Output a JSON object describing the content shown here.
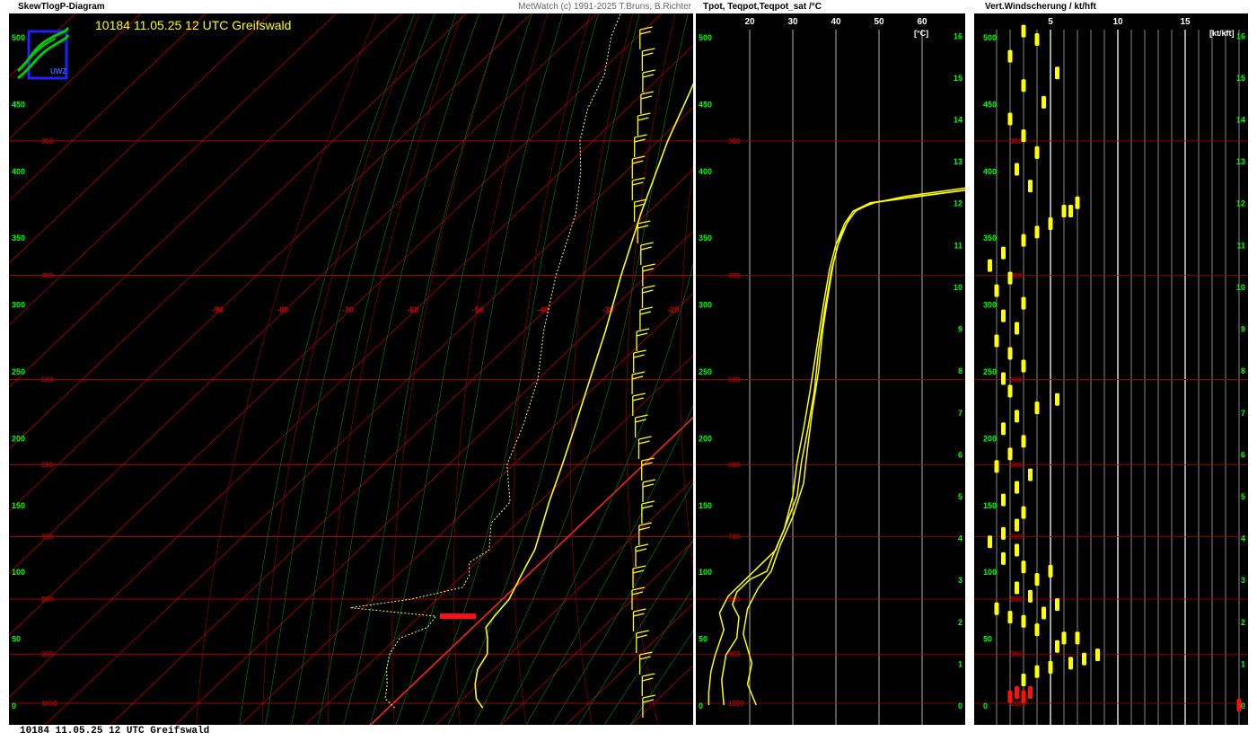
{
  "skewt": {
    "title": "SkewTlogP-Diagram",
    "credit": "MetWatch  (c) 1991-2025 T.Bruns, B.Richter",
    "station_label": "10184 11.05.25 12 UTC Greifswald",
    "logo_text": "UWZ"
  },
  "tpot": {
    "title": "Tpot, Teqpot,Teqpot_sat /°C",
    "unit": "[°C]"
  },
  "shear": {
    "title": "Vert.Windscherung / kt/hft",
    "unit": "[kt/kft]"
  },
  "footer": "10184 11.05.25 12 UTC Greifswald",
  "colors": {
    "background": "#000000",
    "isotherm": "#cc0000",
    "isobar": "#aa0000",
    "dry_adiabat": "#b00000",
    "moist_adiabat": "#008800",
    "temperature": "#ffff00",
    "dewpoint": "#ffff66",
    "axis_green": "#00ff00",
    "zero_isotherm": "#ff2020"
  },
  "chart_data": [
    {
      "type": "line",
      "name_ref": "skewt",
      "pressure_labels": [
        1000,
        900,
        800,
        700,
        600,
        500,
        400,
        300,
        200
      ],
      "pressure_levels": [
        1000,
        900,
        800,
        700,
        600,
        500,
        400,
        300,
        200
      ],
      "isotherm_labels": [
        -90,
        -80,
        -70,
        -60,
        -50,
        -40,
        -30,
        -20,
        -10
      ],
      "height_ticks_hft": [
        0,
        50,
        100,
        150,
        200,
        250,
        300,
        350,
        400,
        450,
        500
      ],
      "temperature_profile": [
        {
          "p": 1010,
          "t": 14.5
        },
        {
          "p": 990,
          "t": 12.0
        },
        {
          "p": 960,
          "t": 9.5
        },
        {
          "p": 930,
          "t": 7.5
        },
        {
          "p": 900,
          "t": 6.5
        },
        {
          "p": 870,
          "t": 4.0
        },
        {
          "p": 850,
          "t": 2.0
        },
        {
          "p": 830,
          "t": 1.5
        },
        {
          "p": 800,
          "t": 1.0
        },
        {
          "p": 780,
          "t": 0.0
        },
        {
          "p": 760,
          "t": -1.0
        },
        {
          "p": 740,
          "t": -2.0
        },
        {
          "p": 720,
          "t": -3.0
        },
        {
          "p": 700,
          "t": -4.5
        },
        {
          "p": 650,
          "t": -8.5
        },
        {
          "p": 600,
          "t": -12.5
        },
        {
          "p": 550,
          "t": -17.0
        },
        {
          "p": 500,
          "t": -22.0
        },
        {
          "p": 450,
          "t": -27.5
        },
        {
          "p": 400,
          "t": -34.0
        },
        {
          "p": 350,
          "t": -41.0
        },
        {
          "p": 300,
          "t": -48.5
        },
        {
          "p": 270,
          "t": -53.0
        },
        {
          "p": 250,
          "t": -56.5
        },
        {
          "p": 230,
          "t": -57.0
        },
        {
          "p": 215,
          "t": -56.0
        },
        {
          "p": 200,
          "t": -55.0
        },
        {
          "p": 190,
          "t": -54.5
        },
        {
          "p": 175,
          "t": -55.0
        },
        {
          "p": 160,
          "t": -55.5
        },
        {
          "p": 150,
          "t": -55.0
        },
        {
          "p": 140,
          "t": -55.5
        },
        {
          "p": 130,
          "t": -56.0
        }
      ],
      "dewpoint_profile": [
        {
          "p": 1010,
          "t": 1.0
        },
        {
          "p": 990,
          "t": -2.0
        },
        {
          "p": 960,
          "t": -4.0
        },
        {
          "p": 930,
          "t": -6.5
        },
        {
          "p": 900,
          "t": -8.5
        },
        {
          "p": 870,
          "t": -9.5
        },
        {
          "p": 850,
          "t": -7.0
        },
        {
          "p": 830,
          "t": -7.5
        },
        {
          "p": 815,
          "t": -22.0
        },
        {
          "p": 800,
          "t": -14.0
        },
        {
          "p": 780,
          "t": -8.0
        },
        {
          "p": 760,
          "t": -9.0
        },
        {
          "p": 740,
          "t": -11.0
        },
        {
          "p": 720,
          "t": -10.0
        },
        {
          "p": 700,
          "t": -12.0
        },
        {
          "p": 680,
          "t": -14.0
        },
        {
          "p": 650,
          "t": -14.5
        },
        {
          "p": 600,
          "t": -21.0
        },
        {
          "p": 550,
          "t": -25.0
        },
        {
          "p": 500,
          "t": -30.0
        },
        {
          "p": 450,
          "t": -37.0
        },
        {
          "p": 400,
          "t": -44.0
        },
        {
          "p": 350,
          "t": -51.0
        },
        {
          "p": 320,
          "t": -57.0
        },
        {
          "p": 300,
          "t": -62.0
        },
        {
          "p": 280,
          "t": -66.0
        },
        {
          "p": 260,
          "t": -69.0
        },
        {
          "p": 240,
          "t": -74.0
        },
        {
          "p": 220,
          "t": -78.0
        },
        {
          "p": 200,
          "t": -82.0
        },
        {
          "p": 180,
          "t": -86.0
        },
        {
          "p": 165,
          "t": -87.0
        },
        {
          "p": 150,
          "t": -86.0
        },
        {
          "p": 135,
          "t": -88.0
        }
      ]
    },
    {
      "type": "line",
      "name_ref": "tpot",
      "x_ticks": [
        20,
        30,
        40,
        50,
        60
      ],
      "height_ticks_kft": [
        0,
        1,
        2,
        3,
        4,
        5,
        6,
        7,
        8,
        9,
        10,
        11,
        12,
        13,
        14,
        15,
        16
      ],
      "xlim": [
        10,
        70
      ],
      "ylim_kft": [
        0,
        16.2
      ],
      "series": [
        {
          "key": "tpot",
          "points": [
            [
              10.5,
              0.0
            ],
            [
              10.5,
              0.3
            ],
            [
              11.0,
              0.8
            ],
            [
              12.0,
              1.2
            ],
            [
              14.0,
              1.8
            ],
            [
              13.0,
              2.2
            ],
            [
              15.0,
              2.6
            ],
            [
              18.0,
              2.9
            ],
            [
              22.0,
              3.3
            ],
            [
              26.0,
              3.7
            ],
            [
              28.0,
              4.2
            ],
            [
              30.0,
              5.0
            ],
            [
              31.0,
              5.8
            ],
            [
              32.5,
              6.6
            ],
            [
              34.0,
              7.5
            ],
            [
              35.5,
              8.5
            ],
            [
              37.0,
              9.5
            ],
            [
              38.5,
              10.4
            ],
            [
              40.0,
              11.0
            ],
            [
              42.0,
              11.5
            ],
            [
              44.0,
              11.8
            ],
            [
              48.0,
              12.0
            ],
            [
              55.0,
              12.1
            ],
            [
              70.0,
              12.3
            ]
          ]
        },
        {
          "key": "teqpot",
          "points": [
            [
              14.0,
              0.0
            ],
            [
              13.5,
              0.6
            ],
            [
              14.5,
              1.2
            ],
            [
              17.0,
              1.6
            ],
            [
              17.5,
              2.1
            ],
            [
              16.0,
              2.4
            ],
            [
              17.0,
              2.7
            ],
            [
              20.0,
              3.0
            ],
            [
              24.0,
              3.2
            ],
            [
              25.5,
              3.6
            ],
            [
              28.0,
              4.2
            ],
            [
              31.0,
              5.0
            ],
            [
              32.0,
              5.8
            ],
            [
              33.5,
              6.6
            ],
            [
              35.0,
              7.5
            ],
            [
              36.0,
              8.5
            ],
            [
              37.5,
              9.5
            ],
            [
              39.0,
              10.4
            ],
            [
              40.5,
              11.0
            ],
            [
              42.5,
              11.5
            ],
            [
              44.5,
              11.8
            ],
            [
              48.5,
              12.0
            ],
            [
              55.5,
              12.1
            ],
            [
              70.0,
              12.3
            ]
          ]
        },
        {
          "key": "teqpot_sat",
          "points": [
            [
              21.5,
              0.0
            ],
            [
              19.5,
              0.5
            ],
            [
              20.5,
              1.0
            ],
            [
              18.5,
              1.7
            ],
            [
              19.5,
              2.3
            ],
            [
              22.0,
              2.8
            ],
            [
              25.0,
              3.2
            ],
            [
              27.0,
              3.8
            ],
            [
              30.0,
              4.5
            ],
            [
              32.5,
              5.3
            ],
            [
              33.5,
              6.2
            ],
            [
              34.5,
              7.0
            ],
            [
              36.0,
              8.0
            ],
            [
              37.0,
              9.0
            ],
            [
              38.5,
              10.0
            ],
            [
              39.5,
              10.6
            ],
            [
              41.0,
              11.2
            ],
            [
              43.0,
              11.6
            ],
            [
              45.0,
              11.85
            ],
            [
              49.0,
              12.0
            ],
            [
              56.0,
              12.15
            ],
            [
              70.0,
              12.35
            ]
          ]
        }
      ]
    },
    {
      "type": "scatter",
      "name_ref": "shear",
      "x_ticks": [
        5,
        10,
        15
      ],
      "height_ticks_kft": [
        0,
        1,
        2,
        3,
        4,
        5,
        6,
        7,
        8,
        9,
        10,
        11,
        12,
        13,
        14,
        15,
        16
      ],
      "xlim": [
        0,
        19
      ],
      "ylim_kft": [
        0,
        16.2
      ],
      "shear_points": [
        [
          2.0,
          0.2,
          "red"
        ],
        [
          2.5,
          0.3,
          "red"
        ],
        [
          3.0,
          0.2,
          "red"
        ],
        [
          3.5,
          0.3,
          "red"
        ],
        [
          19.0,
          0.0,
          "red"
        ],
        [
          3.0,
          0.6,
          "y"
        ],
        [
          4.0,
          0.8,
          "y"
        ],
        [
          5.0,
          0.9,
          "y"
        ],
        [
          6.5,
          1.0,
          "y"
        ],
        [
          7.5,
          1.1,
          "y"
        ],
        [
          8.5,
          1.2,
          "y"
        ],
        [
          5.5,
          1.4,
          "y"
        ],
        [
          6.0,
          1.6,
          "y"
        ],
        [
          7.0,
          1.6,
          "y"
        ],
        [
          4.0,
          1.8,
          "y"
        ],
        [
          3.0,
          2.0,
          "y"
        ],
        [
          2.0,
          2.1,
          "y"
        ],
        [
          1.0,
          2.3,
          "y"
        ],
        [
          4.5,
          2.2,
          "y"
        ],
        [
          5.5,
          2.4,
          "y"
        ],
        [
          3.5,
          2.6,
          "y"
        ],
        [
          2.5,
          2.8,
          "y"
        ],
        [
          4.0,
          3.0,
          "y"
        ],
        [
          5.0,
          3.2,
          "y"
        ],
        [
          3.0,
          3.3,
          "y"
        ],
        [
          1.5,
          3.5,
          "y"
        ],
        [
          2.5,
          3.7,
          "y"
        ],
        [
          0.5,
          3.9,
          "y"
        ],
        [
          1.5,
          4.1,
          "y"
        ],
        [
          2.5,
          4.3,
          "y"
        ],
        [
          3.0,
          4.6,
          "y"
        ],
        [
          1.5,
          4.9,
          "y"
        ],
        [
          2.5,
          5.2,
          "y"
        ],
        [
          3.5,
          5.5,
          "y"
        ],
        [
          1.0,
          5.7,
          "y"
        ],
        [
          2.0,
          6.0,
          "y"
        ],
        [
          3.0,
          6.3,
          "y"
        ],
        [
          1.5,
          6.6,
          "y"
        ],
        [
          2.5,
          6.9,
          "y"
        ],
        [
          4.0,
          7.1,
          "y"
        ],
        [
          5.5,
          7.3,
          "y"
        ],
        [
          2.0,
          7.5,
          "y"
        ],
        [
          1.5,
          7.8,
          "y"
        ],
        [
          3.0,
          8.1,
          "y"
        ],
        [
          2.0,
          8.4,
          "y"
        ],
        [
          1.0,
          8.7,
          "y"
        ],
        [
          2.5,
          9.0,
          "y"
        ],
        [
          1.5,
          9.3,
          "y"
        ],
        [
          3.0,
          9.6,
          "y"
        ],
        [
          1.0,
          9.9,
          "y"
        ],
        [
          2.0,
          10.2,
          "y"
        ],
        [
          0.5,
          10.5,
          "y"
        ],
        [
          1.5,
          10.8,
          "y"
        ],
        [
          3.0,
          11.1,
          "y"
        ],
        [
          4.0,
          11.3,
          "y"
        ],
        [
          5.0,
          11.5,
          "y"
        ],
        [
          6.0,
          11.8,
          "y"
        ],
        [
          7.0,
          12.0,
          "y"
        ],
        [
          6.5,
          11.8,
          "y"
        ],
        [
          3.5,
          12.4,
          "y"
        ],
        [
          2.5,
          12.8,
          "y"
        ],
        [
          4.0,
          13.2,
          "y"
        ],
        [
          3.0,
          13.6,
          "y"
        ],
        [
          2.0,
          14.0,
          "y"
        ],
        [
          4.5,
          14.4,
          "y"
        ],
        [
          3.0,
          14.8,
          "y"
        ],
        [
          5.5,
          15.1,
          "y"
        ],
        [
          2.0,
          15.5,
          "y"
        ],
        [
          4.0,
          15.9,
          "y"
        ],
        [
          3.0,
          16.1,
          "y"
        ]
      ]
    }
  ]
}
